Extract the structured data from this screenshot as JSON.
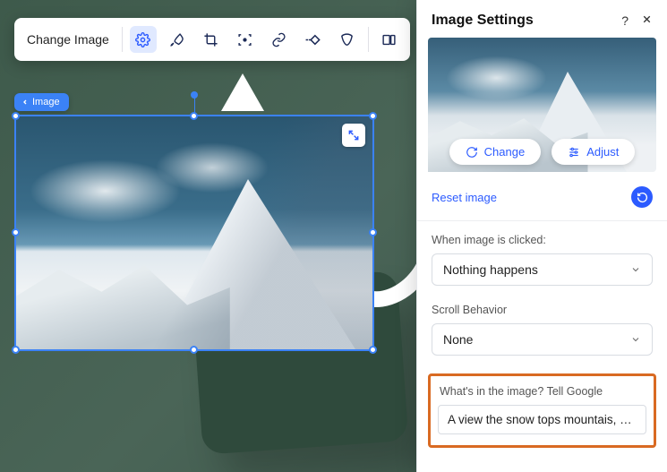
{
  "toolbar": {
    "change_image_label": "Change Image",
    "icons": {
      "settings": "gear-icon",
      "brush": "brush-icon",
      "crop": "crop-icon",
      "focal": "focal-point-icon",
      "link": "link-icon",
      "animation": "animation-icon",
      "mask": "mask-icon",
      "stretch": "stretch-icon"
    }
  },
  "breadcrumb": {
    "label": "Image"
  },
  "canvas_expand": {
    "name": "expand-icon"
  },
  "panel": {
    "title": "Image Settings",
    "help": "?",
    "thumb_buttons": {
      "change": "Change",
      "adjust": "Adjust"
    },
    "reset_label": "Reset image",
    "click_action": {
      "label": "When image is clicked:",
      "value": "Nothing happens"
    },
    "scroll": {
      "label": "Scroll Behavior",
      "value": "None"
    },
    "alt": {
      "label": "What's in the image? Tell Google",
      "value": "A view the snow tops mountais, ever…"
    }
  },
  "colors": {
    "accent": "#2c5bff",
    "highlight_border": "#d96a22"
  }
}
